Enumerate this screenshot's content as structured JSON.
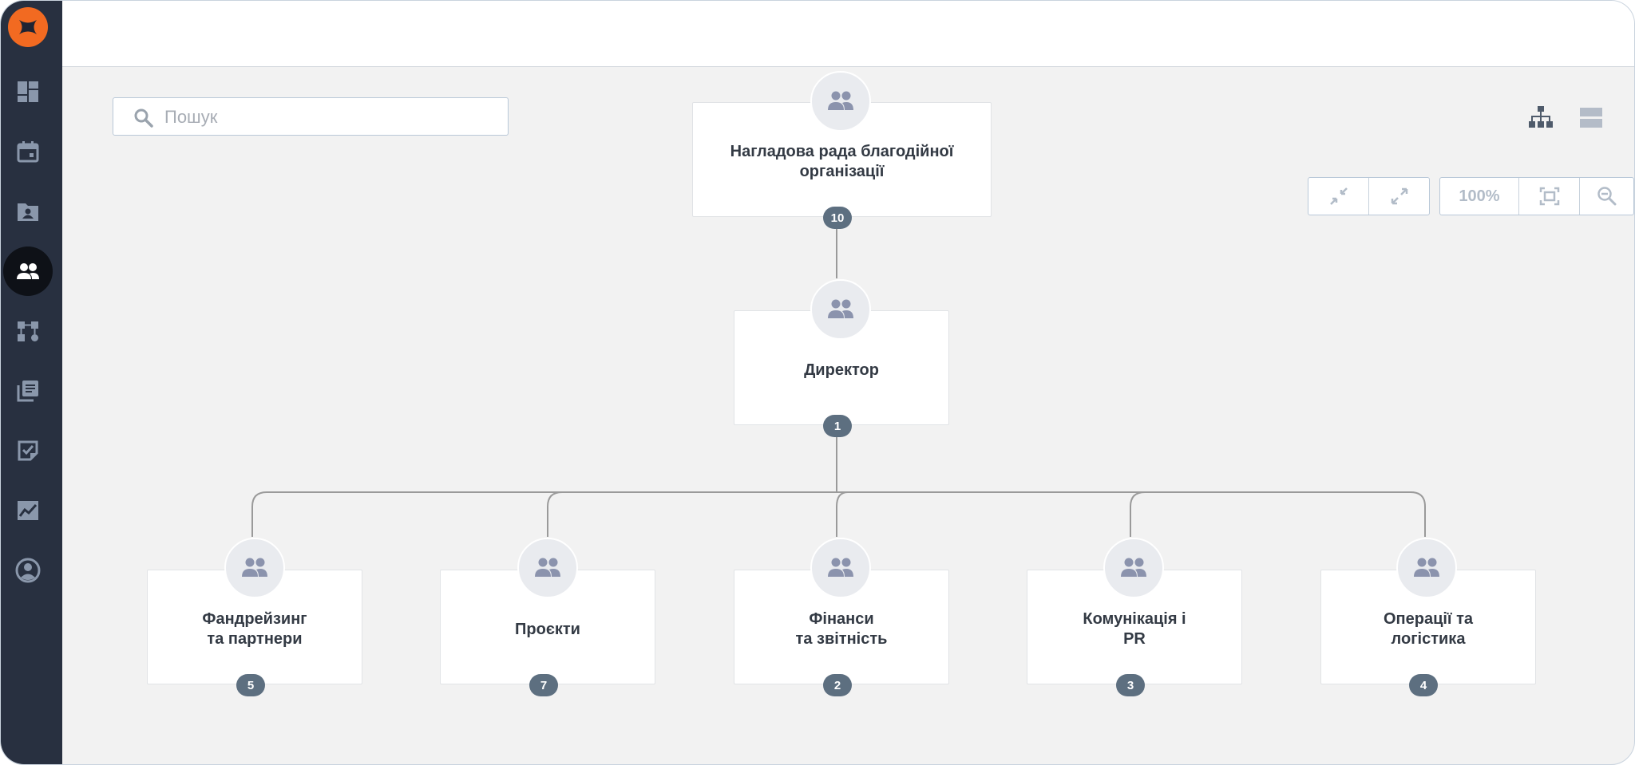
{
  "search": {
    "placeholder": "Пошук",
    "value": ""
  },
  "colors": {
    "sidebar": "#283040",
    "accent": "#f26a21",
    "badge": "#5d6f80",
    "canvas": "#f2f2f2"
  },
  "sidebar": {
    "logo": "app-logo",
    "items": [
      {
        "icon": "dashboard-icon",
        "active": false
      },
      {
        "icon": "calendar-icon",
        "active": false
      },
      {
        "icon": "contacts-folder-icon",
        "active": false
      },
      {
        "icon": "groups-icon",
        "active": true
      },
      {
        "icon": "workflow-icon",
        "active": false
      },
      {
        "icon": "library-icon",
        "active": false
      },
      {
        "icon": "tasks-icon",
        "active": false
      },
      {
        "icon": "analytics-icon",
        "active": false
      },
      {
        "icon": "account-icon",
        "active": false
      }
    ]
  },
  "view_toggle": {
    "tree": "org-tree-icon",
    "list": "list-view-icon",
    "active": "tree"
  },
  "toolbar": {
    "collapse": "collapse-icon",
    "expand": "expand-icon",
    "zoom_label": "100%",
    "fit": "fit-screen-icon",
    "zoom_out": "zoom-out-icon"
  },
  "org": {
    "root": {
      "title": "Нагладова рада благодійної\nорганізації",
      "count": "10"
    },
    "director": {
      "title": "Директор",
      "count": "1"
    },
    "departments": [
      {
        "title": "Фандрейзинг\nта партнери",
        "count": "5"
      },
      {
        "title": "Проєкти",
        "count": "7"
      },
      {
        "title": "Фінанси\nта звітність",
        "count": "2"
      },
      {
        "title": "Комунікація і\nPR",
        "count": "3"
      },
      {
        "title": "Операції та\nлогістика",
        "count": "4"
      }
    ]
  }
}
